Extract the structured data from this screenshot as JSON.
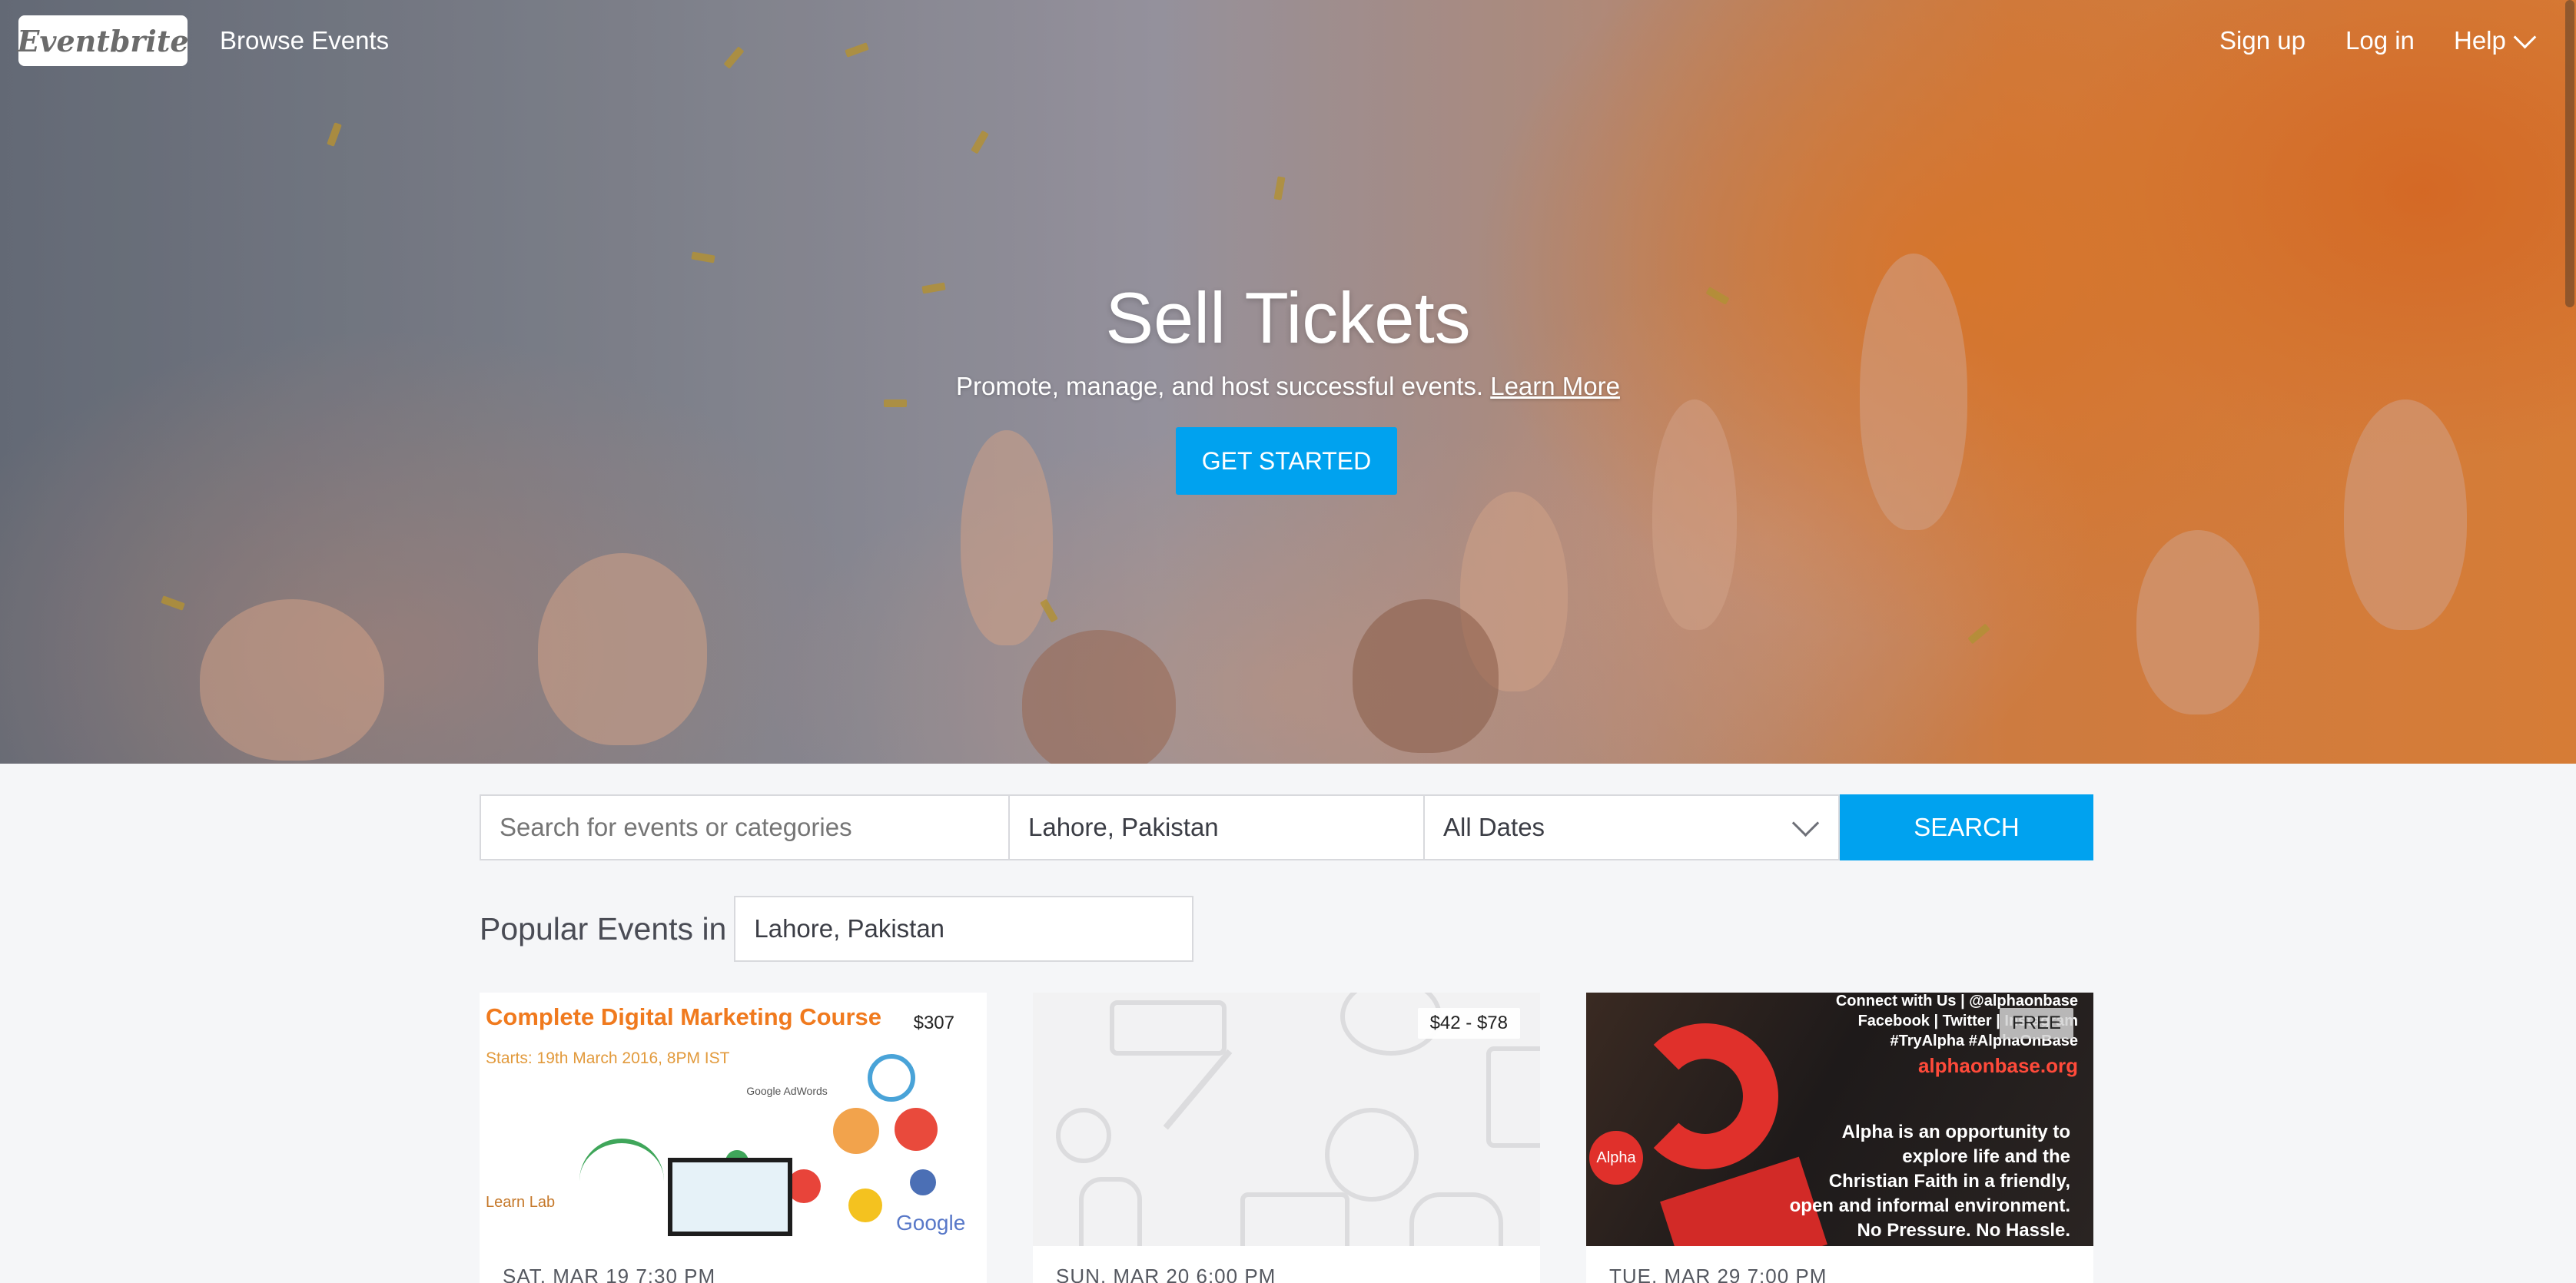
{
  "nav": {
    "logo": "Eventbrite",
    "browse": "Browse Events",
    "signup": "Sign up",
    "login": "Log in",
    "help": "Help"
  },
  "hero": {
    "title": "Sell Tickets",
    "subtitle": "Promote, manage, and host successful events.",
    "learn_more": "Learn More",
    "cta": "GET STARTED"
  },
  "search": {
    "placeholder": "Search for events or categories",
    "location": "Lahore, Pakistan",
    "dates": "All Dates",
    "button": "SEARCH"
  },
  "popular": {
    "label": "Popular Events in",
    "location": "Lahore, Pakistan"
  },
  "events": [
    {
      "price": "$307",
      "date": "SAT, MAR 19 7:30 PM",
      "image_title": "Complete Digital Marketing Course",
      "image_starts": "Starts: 19th March 2016, 8PM IST",
      "image_brand": "Learn Lab",
      "image_partner": "Google",
      "image_partner_small": "Google AdWords"
    },
    {
      "price": "$42 - $78",
      "date": "SUN, MAR 20 6:00 PM"
    },
    {
      "price": "FREE",
      "date": "TUE, MAR 29 7:00 PM",
      "image_line1": "Connect with Us | @alphaonbase",
      "image_line2": "Facebook | Twitter | Instagram",
      "image_line3": "#TryAlpha #AlphaOnBase",
      "image_site": "alphaonbase.org",
      "image_body": [
        "Alpha is an opportunity to",
        "explore life and the",
        "Christian Faith in a friendly,",
        "open and informal environment.",
        "No Pressure. No Hassle."
      ],
      "image_badge": "Alpha"
    }
  ],
  "colors": {
    "accent": "#00a2ef",
    "hero_orange": "#f28b3a",
    "page_bg": "#f5f6f8"
  }
}
